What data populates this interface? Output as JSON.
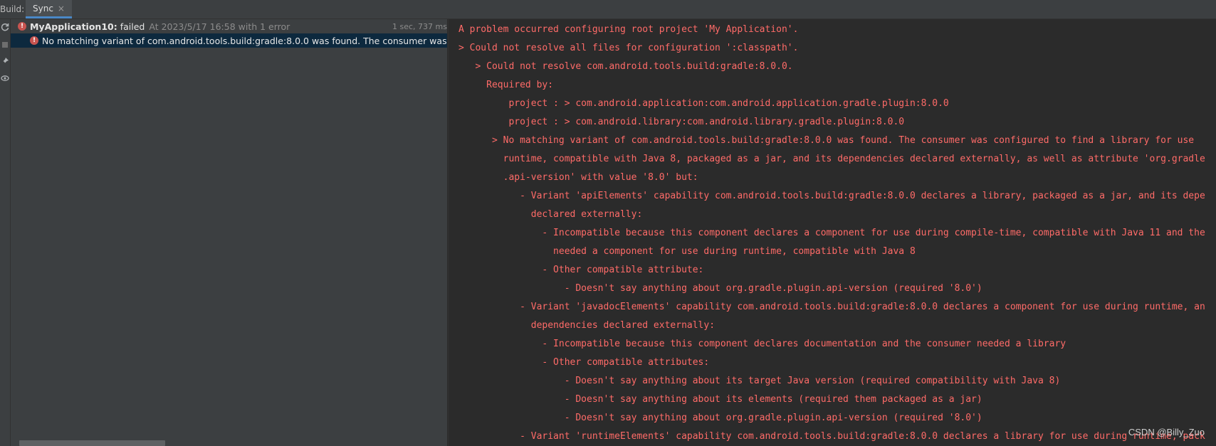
{
  "header": {
    "build_label": "Build:",
    "tab_label": "Sync",
    "tab_close": "×"
  },
  "toolstrip": {
    "icons": [
      "refresh-icon",
      "stop-icon",
      "pin-icon",
      "eye-icon"
    ]
  },
  "tree": {
    "root": {
      "project": "MyApplication10:",
      "status": "failed",
      "time": "At 2023/5/17 16:58 with 1 error",
      "duration": "1 sec, 737 ms"
    },
    "child": {
      "message": "No matching variant of com.android.tools.build:gradle:8.0.0 was found. The consumer was configu"
    }
  },
  "console": {
    "lines": [
      "A problem occurred configuring root project 'My Application'.",
      "> Could not resolve all files for configuration ':classpath'.",
      "   > Could not resolve com.android.tools.build:gradle:8.0.0.",
      "     Required by:",
      "         project : > com.android.application:com.android.application.gradle.plugin:8.0.0",
      "         project : > com.android.library:com.android.library.gradle.plugin:8.0.0",
      "      > No matching variant of com.android.tools.build:gradle:8.0.0 was found. The consumer was configured to find a library for use",
      "        runtime, compatible with Java 8, packaged as a jar, and its dependencies declared externally, as well as attribute 'org.gradle",
      "        .api-version' with value '8.0' but:",
      "           - Variant 'apiElements' capability com.android.tools.build:gradle:8.0.0 declares a library, packaged as a jar, and its depe",
      "             declared externally:",
      "               - Incompatible because this component declares a component for use during compile-time, compatible with Java 11 and the",
      "                 needed a component for use during runtime, compatible with Java 8",
      "               - Other compatible attribute:",
      "                   - Doesn't say anything about org.gradle.plugin.api-version (required '8.0')",
      "           - Variant 'javadocElements' capability com.android.tools.build:gradle:8.0.0 declares a component for use during runtime, an",
      "             dependencies declared externally:",
      "               - Incompatible because this component declares documentation and the consumer needed a library",
      "               - Other compatible attributes:",
      "                   - Doesn't say anything about its target Java version (required compatibility with Java 8)",
      "                   - Doesn't say anything about its elements (required them packaged as a jar)",
      "                   - Doesn't say anything about org.gradle.plugin.api-version (required '8.0')",
      "           - Variant 'runtimeElements' capability com.android.tools.build:gradle:8.0.0 declares a library for use during runtime, pack"
    ]
  },
  "watermark": "CSDN @Billy_Zuo",
  "colors": {
    "error_text": "#ff6b68",
    "selection": "#0d293e",
    "panel": "#3c3f41",
    "console_bg": "#2b2b2b"
  }
}
